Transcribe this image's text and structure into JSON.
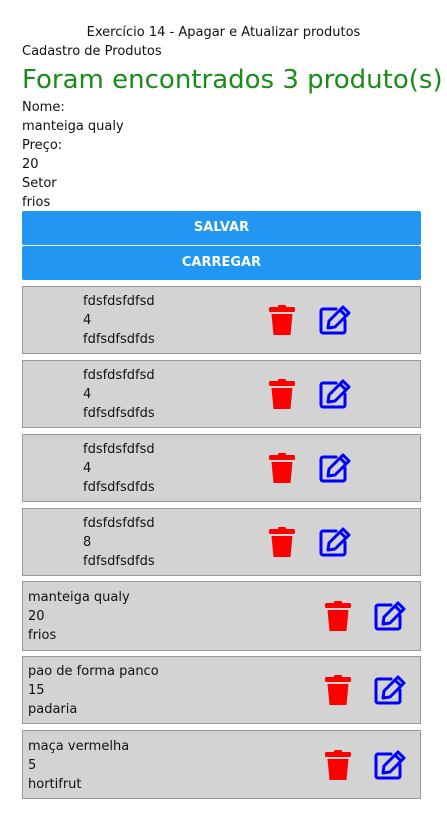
{
  "header": {
    "title": "Exercício 14 - Apagar e Atualizar produtos"
  },
  "form": {
    "section_title": "Cadastro de Produtos",
    "result_heading": "Foram encontrados 3 produto(s)",
    "name_label": "Nome:",
    "name_value": "manteiga qualy",
    "price_label": "Preço:",
    "price_value": "20",
    "sector_label": "Setor",
    "sector_value": "frios",
    "save_label": "SALVAR",
    "load_label": "CARREGAR"
  },
  "colors": {
    "primary": "#2196f3",
    "delete": "#ff0000",
    "edit": "#0000ff",
    "success": "#1a8c1a",
    "card_bg": "#d3d3d3"
  },
  "products": [
    {
      "name": "fdsfdsfdfsd",
      "price": "4",
      "sector": "fdfsdfsdfds",
      "delete_icon": "trash-icon",
      "edit_icon": "edit-icon"
    },
    {
      "name": "fdsfdsfdfsd",
      "price": "4",
      "sector": "fdfsdfsdfds",
      "delete_icon": "trash-icon",
      "edit_icon": "edit-icon"
    },
    {
      "name": "fdsfdsfdfsd",
      "price": "4",
      "sector": "fdfsdfsdfds",
      "delete_icon": "trash-icon",
      "edit_icon": "edit-icon"
    },
    {
      "name": "fdsfdsfdfsd",
      "price": "8",
      "sector": "fdfsdfsdfds",
      "delete_icon": "trash-icon",
      "edit_icon": "edit-icon"
    },
    {
      "name": "manteiga qualy",
      "price": "20",
      "sector": "frios",
      "delete_icon": "trash-icon",
      "edit_icon": "edit-icon"
    },
    {
      "name": "pao de forma panco",
      "price": "15",
      "sector": "padaria",
      "delete_icon": "trash-icon",
      "edit_icon": "edit-icon"
    },
    {
      "name": "maça vermelha",
      "price": "5",
      "sector": "hortifrut",
      "delete_icon": "trash-icon",
      "edit_icon": "edit-icon"
    }
  ]
}
